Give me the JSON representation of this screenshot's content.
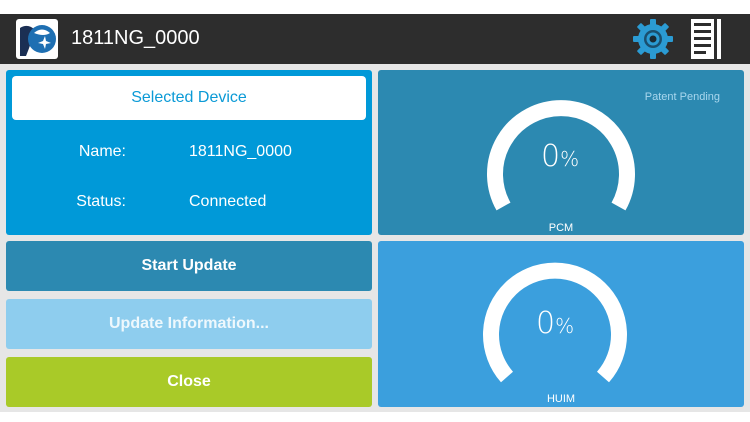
{
  "header": {
    "title": "1811NG_0000"
  },
  "device": {
    "heading": "Selected Device",
    "name_label": "Name:",
    "name_value": "1811NG_0000",
    "status_label": "Status:",
    "status_value": "Connected"
  },
  "buttons": {
    "start_update": "Start Update",
    "update_information": "Update Information...",
    "close": "Close"
  },
  "gauges": {
    "patent": "Patent Pending",
    "pcm": {
      "label": "PCM",
      "value": "0",
      "unit": "%",
      "progress": 0
    },
    "huim": {
      "label": "HUIM",
      "value": "0",
      "unit": "%",
      "progress": 0
    }
  },
  "icons": {
    "logo": "app-logo",
    "settings": "gear-icon",
    "document": "document-icon"
  },
  "colors": {
    "header": "#2d2d2d",
    "info_panel": "#0099d8",
    "start_button": "#2c89b1",
    "info_button": "#8ecdee",
    "close_button": "#a9ca28",
    "pcm_panel": "#2c89b1",
    "huim_panel": "#3b9fdd",
    "gear": "#2b9bd3"
  }
}
